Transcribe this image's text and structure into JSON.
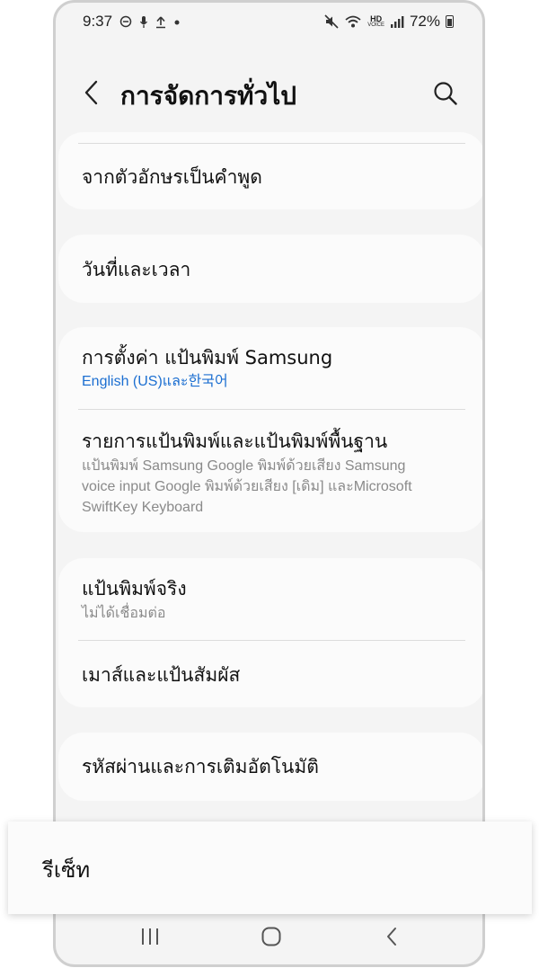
{
  "status_bar": {
    "time": "9:37",
    "battery_percent": "72%",
    "hd_top": "HD",
    "hd_bottom": "VOICE",
    "left_icons": [
      "do-not-disturb-icon",
      "mic-icon",
      "upload-icon",
      "dot-icon"
    ],
    "right_icons": [
      "mute-icon",
      "wifi-icon",
      "hd-voice-icon",
      "signal-icon",
      "battery-icon"
    ]
  },
  "header": {
    "title": "การจัดการทั่วไป"
  },
  "settings": {
    "tts": {
      "title": "จากตัวอักษรเป็นคำพูด"
    },
    "date_time": {
      "title": "วันที่และเวลา"
    },
    "samsung_keyboard": {
      "title": "การตั้งค่า แป้นพิมพ์ Samsung",
      "subtitle": "English (US)และ한국어"
    },
    "keyboard_list": {
      "title": "รายการแป้นพิมพ์และแป้นพิมพ์พื้นฐาน",
      "subtitle_line1": "แป้นพิมพ์ Samsung Google พิมพ์ด้วยเสียง Samsung",
      "subtitle_line2": "voice input Google พิมพ์ด้วยเสียง [เดิม] และMicrosoft",
      "subtitle_line3": "SwiftKey Keyboard"
    },
    "physical_keyboard": {
      "title": "แป้นพิมพ์จริง",
      "subtitle": "ไม่ได้เชื่อมต่อ"
    },
    "mouse_trackpad": {
      "title": "เมาส์และแป้นสัมผัส"
    },
    "passwords_autofill": {
      "title": "รหัสผ่านและการเติมอัตโนมัติ"
    }
  },
  "reset_overlay": {
    "label": "รีเซ็ท"
  },
  "nav_bar": {
    "icons": [
      "recent-apps-icon",
      "home-icon",
      "back-icon"
    ]
  },
  "colors": {
    "background": "#f4f4f4",
    "card": "#fbfbfb",
    "accent_blue": "#1c6fd1",
    "secondary_text": "#8a8a8a"
  }
}
